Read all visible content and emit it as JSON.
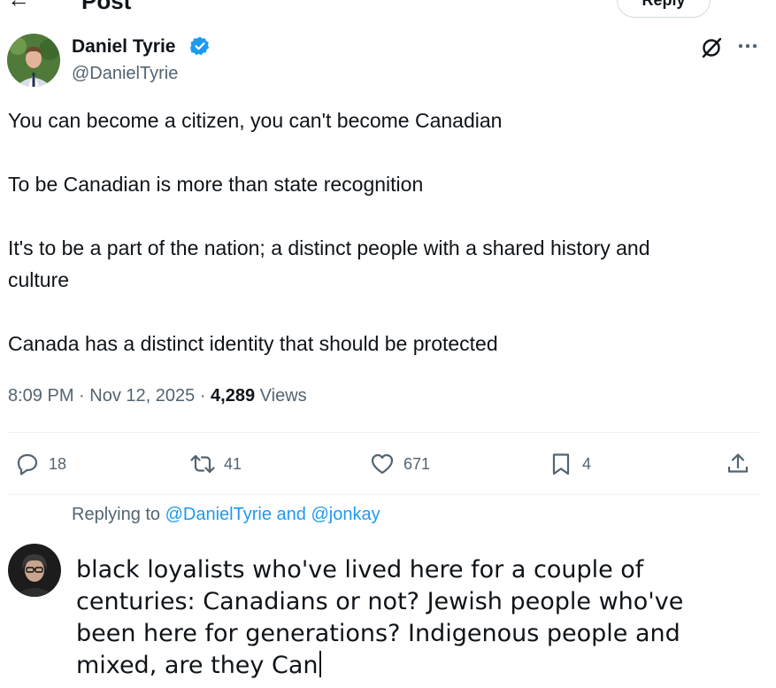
{
  "header": {
    "title": "Post",
    "reply_button": "Reply"
  },
  "author": {
    "name": "Daniel Tyrie",
    "handle": "@DanielTyrie"
  },
  "post": {
    "lines": [
      "You can become a citizen, you can't become Canadian",
      "To be Canadian is more than state recognition",
      "It's to be a part of the nation; a distinct people with a shared history and",
      "culture",
      "Canada has a distinct identity that should be protected"
    ],
    "time": "8:09 PM",
    "date": "Nov 12, 2025",
    "views_count": "4,289",
    "views_label": "Views"
  },
  "actions": {
    "replies": "18",
    "reposts": "41",
    "likes": "671",
    "bookmarks": "4"
  },
  "reply": {
    "replying_to_label": "Replying to",
    "mentions": "@DanielTyrie and @jonkay",
    "draft_lines": [
      "black loyalists who've lived here for a couple of",
      "centuries: Canadians or not? Jewish people who've",
      "been here for generations? Indigenous people and",
      "mixed, are they Can"
    ]
  },
  "colors": {
    "accent": "#1d9bf0",
    "secondary_text": "#536471",
    "primary_text": "#0f1419"
  }
}
